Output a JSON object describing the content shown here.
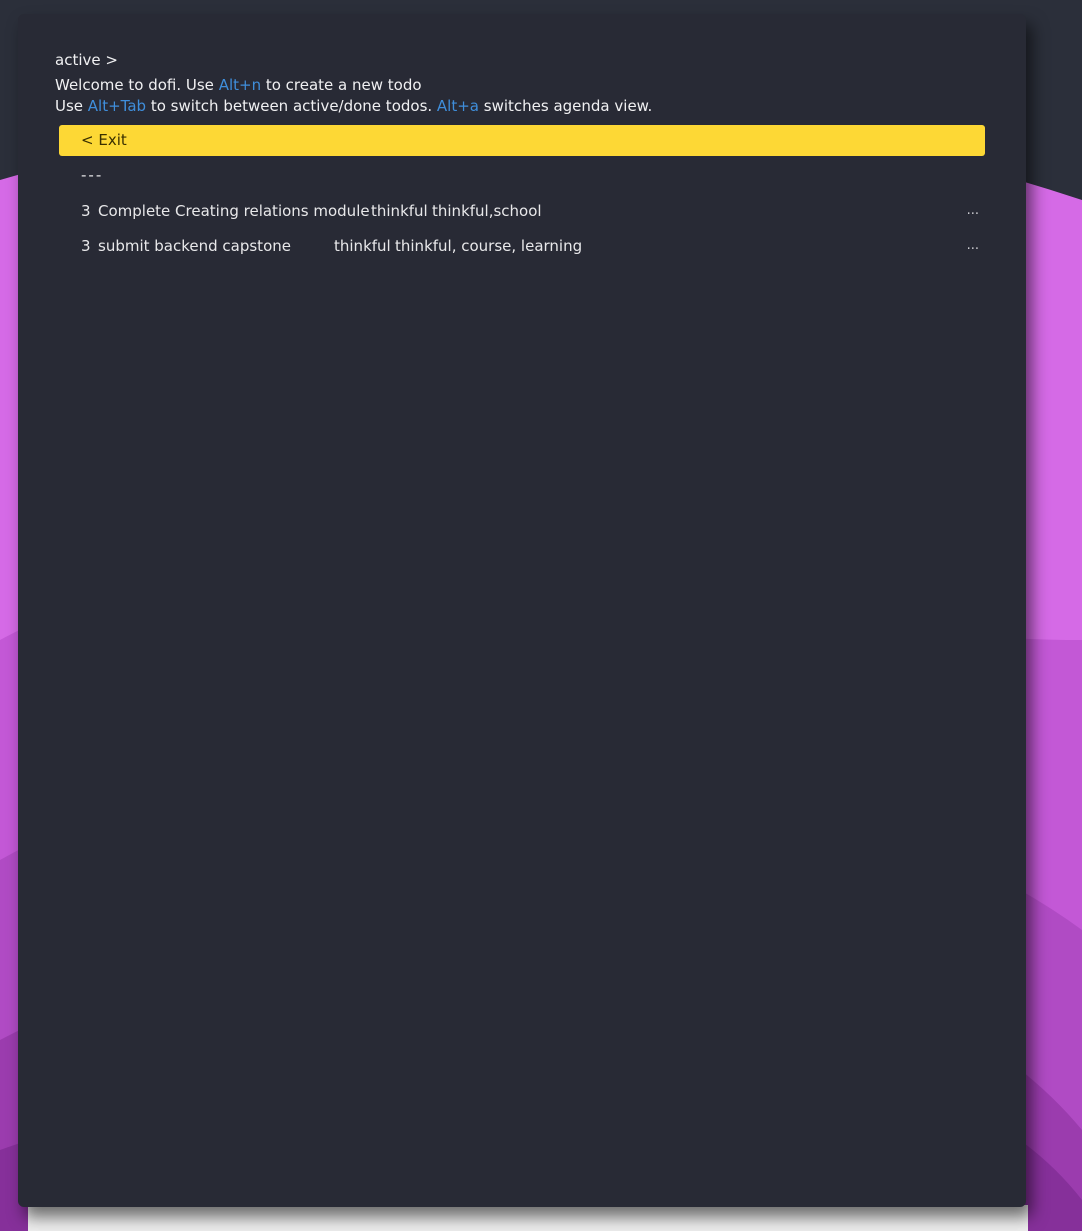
{
  "app": {
    "prompt": "active >",
    "welcome": {
      "line1_pre": "Welcome to dofi. Use ",
      "line1_key": "Alt+n",
      "line1_post": " to create a new todo",
      "line2_pre": "Use ",
      "line2_key1": "Alt+Tab",
      "line2_mid": " to switch between active/done todos. ",
      "line2_key2": "Alt+a",
      "line2_post": " switches agenda view."
    }
  },
  "menu": {
    "exit_label": "< Exit",
    "separator": "---"
  },
  "todos": [
    {
      "priority": "3",
      "title": "Complete Creating relations module",
      "project": "thinkful",
      "tags": "thinkful,school",
      "more": "..."
    },
    {
      "priority": "3",
      "title": "submit backend capstone",
      "project": "thinkful",
      "tags": "thinkful, course, learning",
      "more": "..."
    }
  ],
  "colors": {
    "highlight": "#fdd835",
    "key_accent": "#3f8edb",
    "window_bg": "#282a35",
    "desktop_bg": "#2b2f3a",
    "wallpaper_purple": "#d56ae6"
  }
}
